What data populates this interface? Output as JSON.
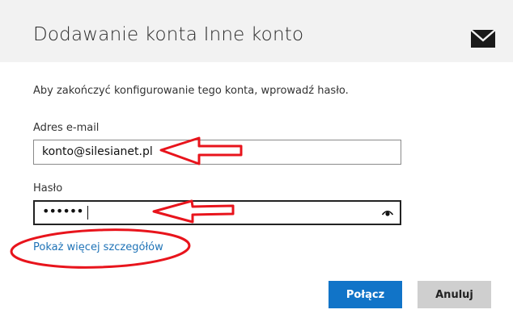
{
  "header": {
    "title": "Dodawanie konta Inne konto",
    "icon": "mail-icon",
    "background": "#f2f2f2"
  },
  "form": {
    "instruction": "Aby zakończyć konfigurowanie tego konta, wprowadź hasło.",
    "email": {
      "label": "Adres e-mail",
      "value": "konto@silesianet.pl"
    },
    "password": {
      "label": "Hasło",
      "masked_value": "••••••",
      "reveal_icon": "eye-icon"
    },
    "more_details_link": "Pokaż więcej szczegółów"
  },
  "buttons": {
    "connect": "Połącz",
    "cancel": "Anuluj"
  },
  "annotations": {
    "color": "#e8141c",
    "shapes": [
      "arrow-to-email-field",
      "arrow-to-password-field",
      "ellipse-around-more-details-link"
    ]
  },
  "colors": {
    "accent": "#1174c8",
    "link": "#1f73b7",
    "cancel_button": "#cfcfcf"
  }
}
